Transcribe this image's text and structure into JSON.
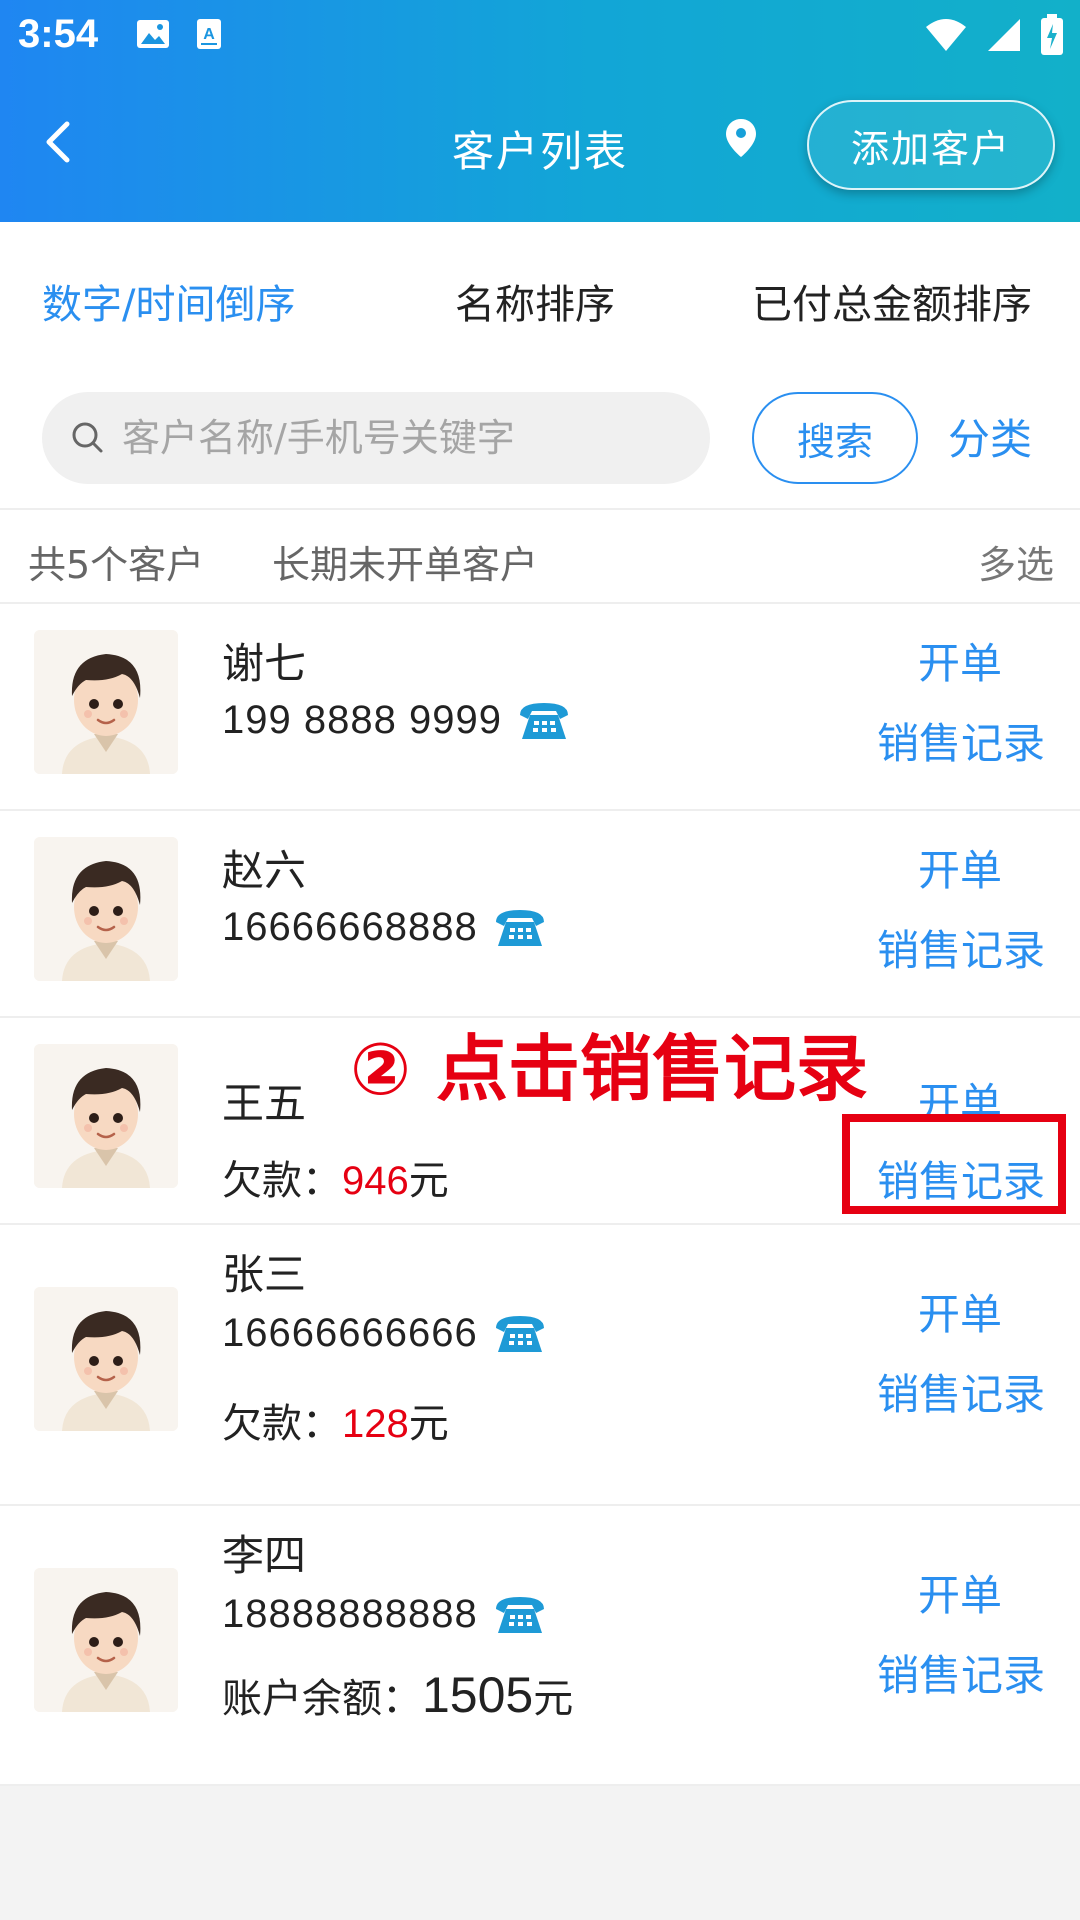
{
  "status_bar": {
    "time": "3:54",
    "icons_left": [
      "image-icon",
      "a-keyboard-icon"
    ],
    "icons_right": [
      "wifi-icon",
      "signal-icon",
      "battery-icon"
    ]
  },
  "navbar": {
    "title": "客户列表",
    "add_button": "添加客户"
  },
  "sort_tabs": [
    {
      "label": "数字/时间倒序",
      "active": true
    },
    {
      "label": "名称排序",
      "active": false
    },
    {
      "label": "已付总金额排序",
      "active": false
    }
  ],
  "search": {
    "placeholder": "客户名称/手机号关键字",
    "button": "搜索",
    "category": "分类"
  },
  "summary": {
    "count": "共5个客户",
    "inactive": "长期未开单客户",
    "multi_select": "多选"
  },
  "actions": {
    "open_order": "开单",
    "sales_record": "销售记录"
  },
  "customers": [
    {
      "name": "谢七",
      "phone": "199 8888 9999"
    },
    {
      "name": "赵六",
      "phone": "16666668888"
    },
    {
      "name": "王五",
      "debt_label": "欠款：",
      "debt_amount": "946",
      "unit": "元"
    },
    {
      "name": "张三",
      "phone": "16666666666",
      "debt_label": "欠款：",
      "debt_amount": "128",
      "unit": "元"
    },
    {
      "name": "李四",
      "phone": "18888888888",
      "balance_label": "账户余额：",
      "balance_amount": "1505",
      "unit": "元"
    }
  ],
  "annotation": {
    "text": "② 点击销售记录"
  },
  "colors": {
    "accent": "#2a8ff0",
    "debt": "#e60012",
    "header_start": "#1f86f2",
    "header_end": "#12b0c9",
    "phone_icon": "#1e9ad6"
  }
}
